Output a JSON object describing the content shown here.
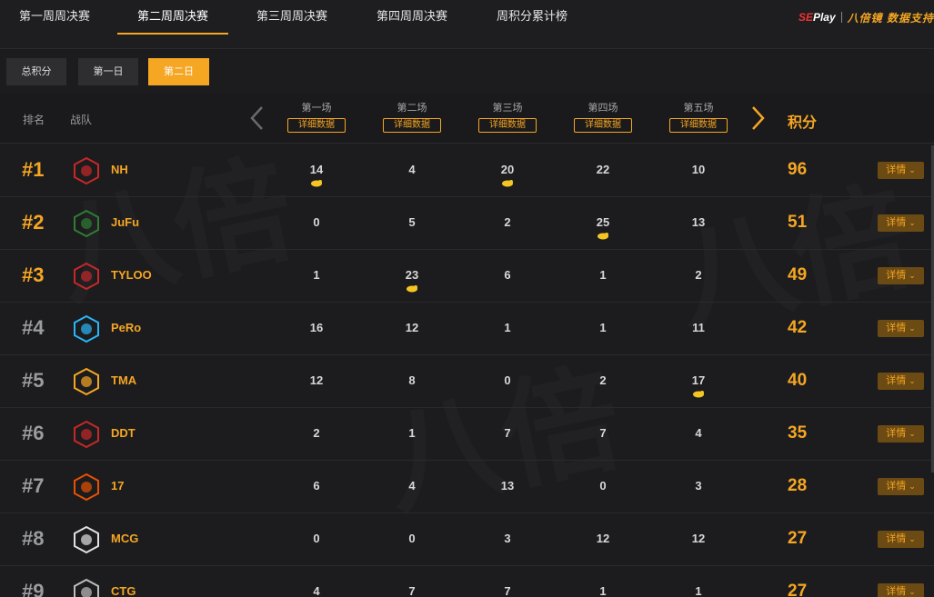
{
  "topnav": {
    "tabs": [
      {
        "label": "第一周周决赛"
      },
      {
        "label": "第二周周决赛"
      },
      {
        "label": "第三周周决赛"
      },
      {
        "label": "第四周周决赛"
      },
      {
        "label": "周积分累计榜"
      }
    ],
    "active_index": 1,
    "brand": {
      "logo1_prefix": "SE",
      "logo1_suffix": "Play",
      "logo2": "八倍镜 数据支持"
    }
  },
  "subtabs": {
    "items": [
      {
        "label": "总积分"
      },
      {
        "label": "第一日"
      },
      {
        "label": "第二日"
      }
    ],
    "active_index": 2
  },
  "table": {
    "rank_header": "排名",
    "team_header": "战队",
    "score_header": "积分",
    "rounds": [
      {
        "name": "第一场",
        "button": "详细数据"
      },
      {
        "name": "第二场",
        "button": "详细数据"
      },
      {
        "name": "第三场",
        "button": "详细数据"
      },
      {
        "name": "第四场",
        "button": "详细数据"
      },
      {
        "name": "第五场",
        "button": "详细数据"
      }
    ],
    "detail_label": "详情",
    "rows": [
      {
        "rank": "#1",
        "team": "NH",
        "scores": [
          "14",
          "4",
          "20",
          "22",
          "10"
        ],
        "chicken": [
          true,
          false,
          true,
          false,
          false
        ],
        "total": "96"
      },
      {
        "rank": "#2",
        "team": "JuFu",
        "scores": [
          "0",
          "5",
          "2",
          "25",
          "13"
        ],
        "chicken": [
          false,
          false,
          false,
          true,
          false
        ],
        "total": "51"
      },
      {
        "rank": "#3",
        "team": "TYLOO",
        "scores": [
          "1",
          "23",
          "6",
          "1",
          "2"
        ],
        "chicken": [
          false,
          true,
          false,
          false,
          false
        ],
        "total": "49"
      },
      {
        "rank": "#4",
        "team": "PeRo",
        "scores": [
          "16",
          "12",
          "1",
          "1",
          "11"
        ],
        "chicken": [
          false,
          false,
          false,
          false,
          false
        ],
        "total": "42"
      },
      {
        "rank": "#5",
        "team": "TMA",
        "scores": [
          "12",
          "8",
          "0",
          "2",
          "17"
        ],
        "chicken": [
          false,
          false,
          false,
          false,
          true
        ],
        "total": "40"
      },
      {
        "rank": "#6",
        "team": "DDT",
        "scores": [
          "2",
          "1",
          "7",
          "7",
          "4"
        ],
        "chicken": [
          false,
          false,
          false,
          false,
          false
        ],
        "total": "35"
      },
      {
        "rank": "#7",
        "team": "17",
        "scores": [
          "6",
          "4",
          "13",
          "0",
          "3"
        ],
        "chicken": [
          false,
          false,
          false,
          false,
          false
        ],
        "total": "28"
      },
      {
        "rank": "#8",
        "team": "MCG",
        "scores": [
          "0",
          "0",
          "3",
          "12",
          "12"
        ],
        "chicken": [
          false,
          false,
          false,
          false,
          false
        ],
        "total": "27"
      },
      {
        "rank": "#9",
        "team": "CTG",
        "scores": [
          "4",
          "7",
          "7",
          "1",
          "1"
        ],
        "chicken": [
          false,
          false,
          false,
          false,
          false
        ],
        "total": "27"
      }
    ]
  },
  "colors": {
    "accent": "#f5a623",
    "background": "#1c1c1e",
    "rank_gray": "#9a9ca0",
    "detail_bg": "#6b4a13"
  }
}
